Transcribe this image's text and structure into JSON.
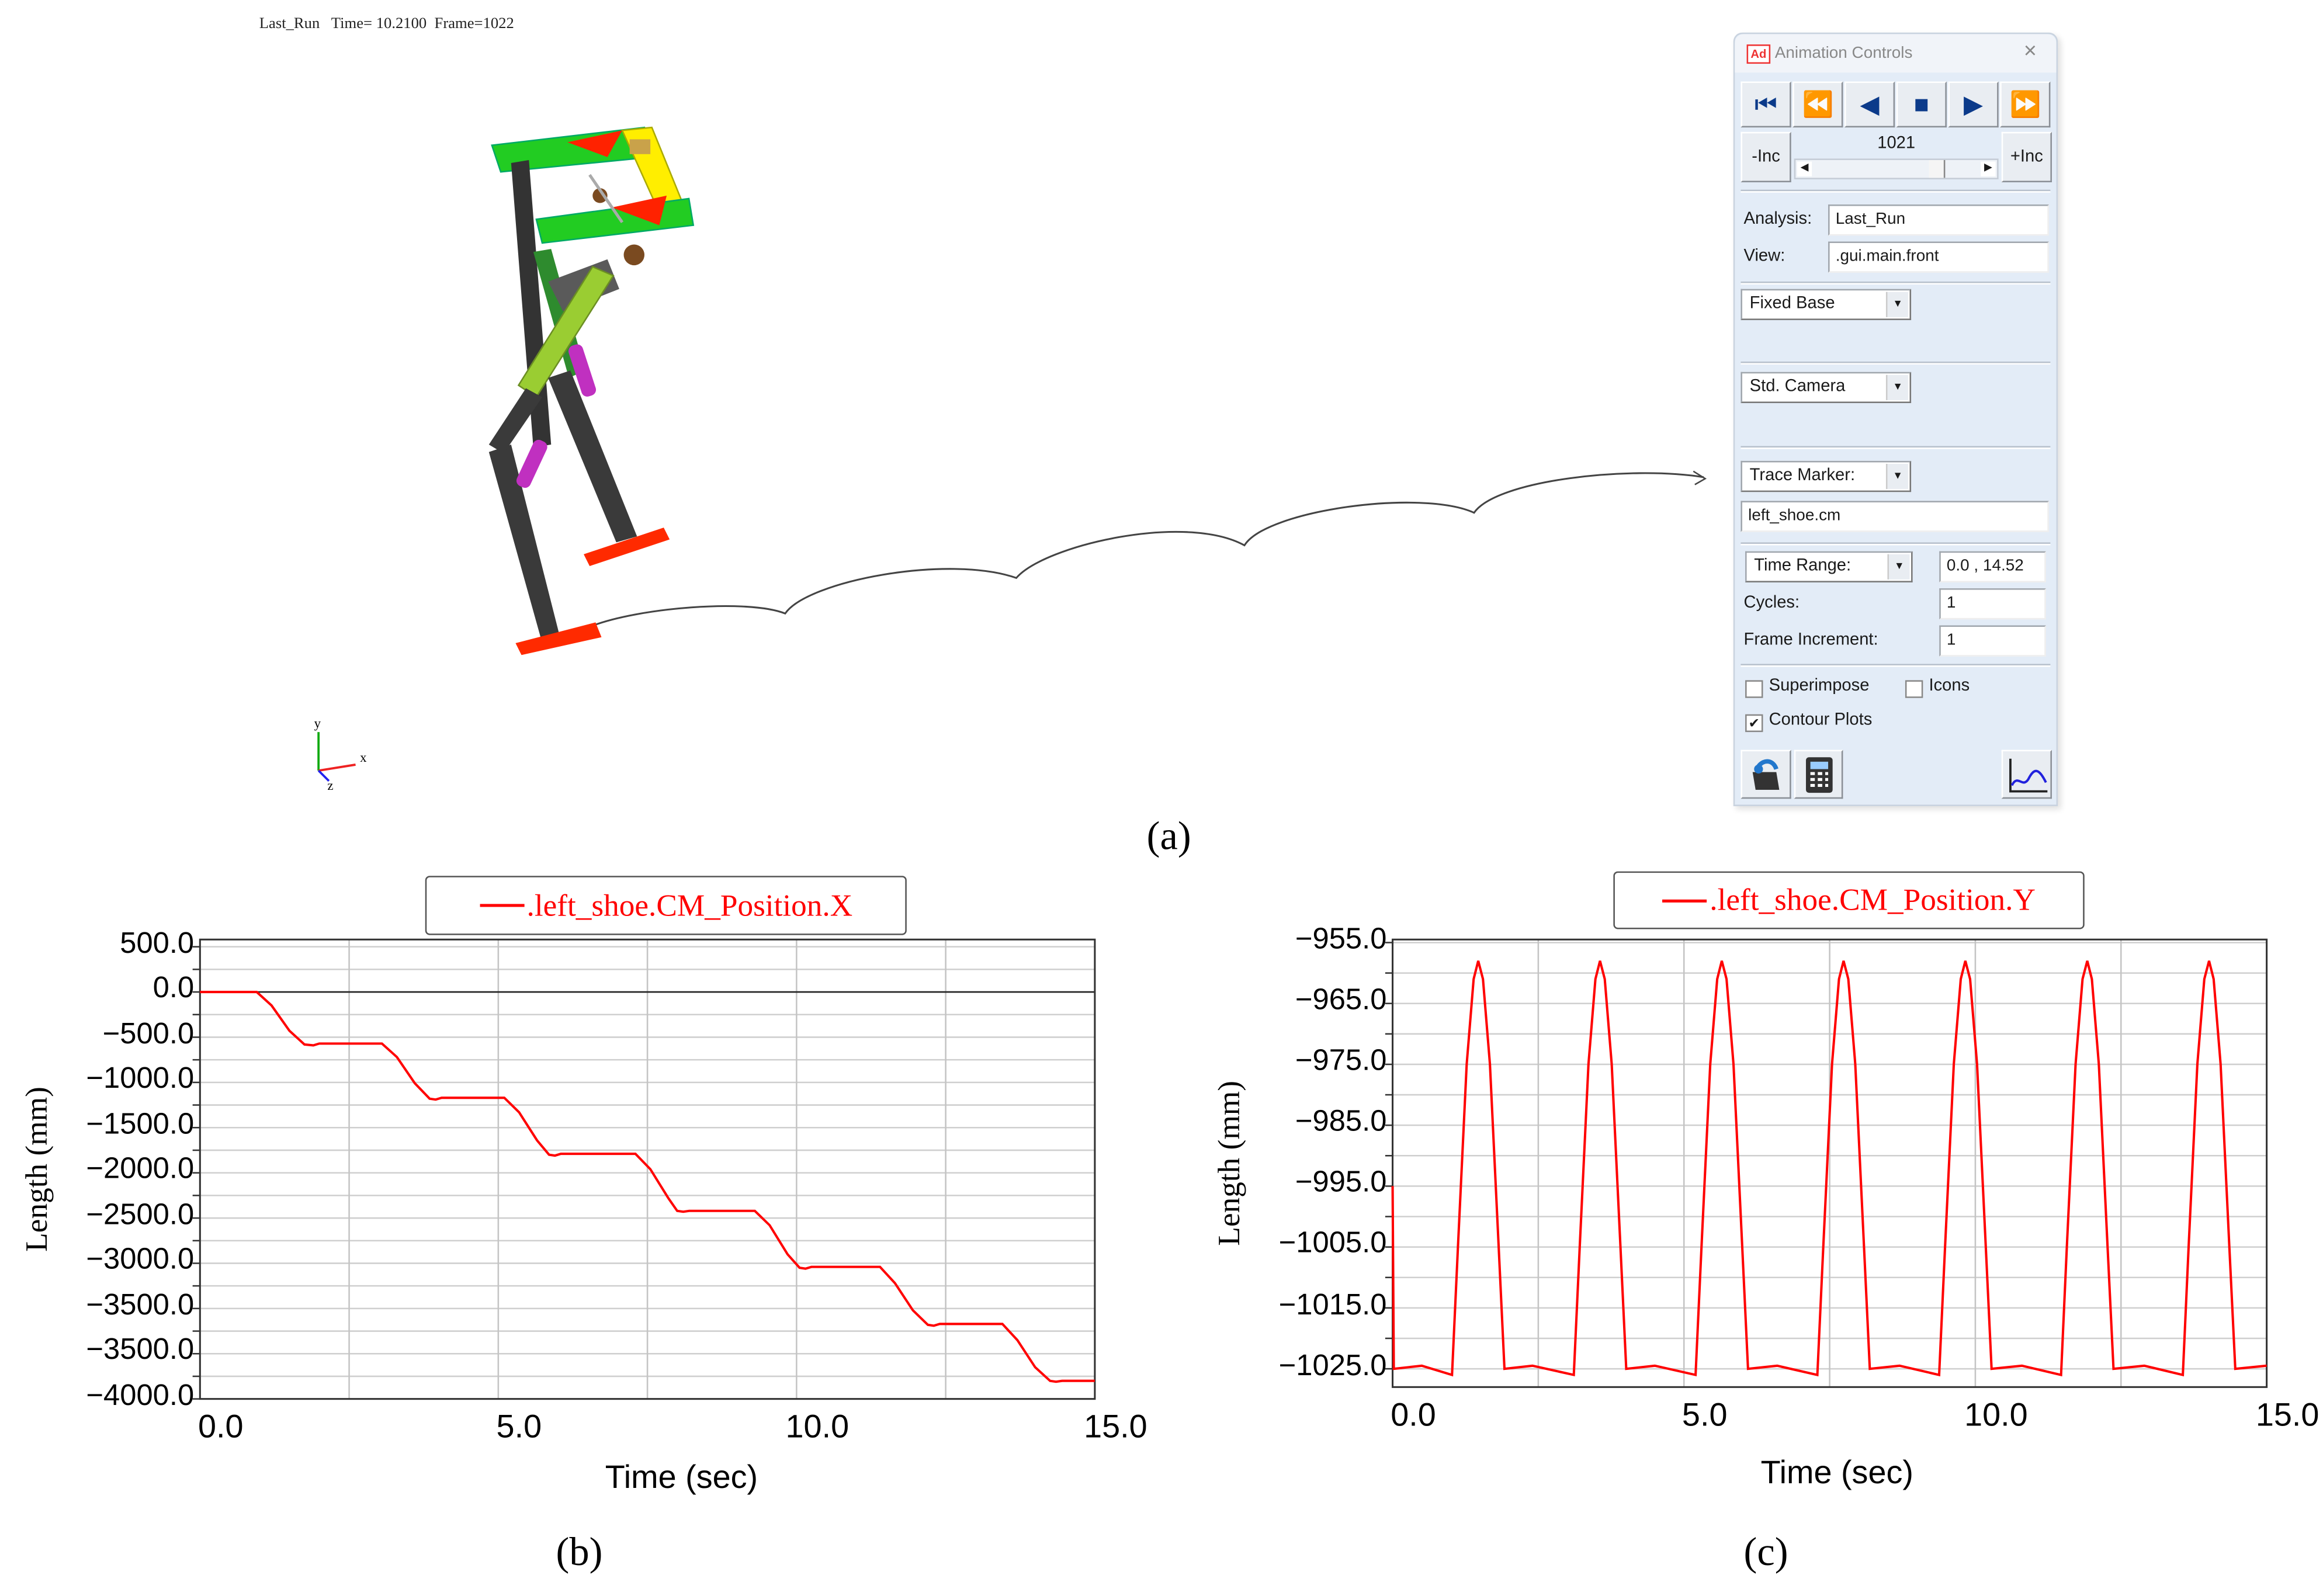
{
  "viewport": {
    "header": "Last_Run   Time= 10.2100  Frame=1022",
    "axis_labels": {
      "y": "y",
      "x": "x",
      "z": "z"
    },
    "trace_color": "#444444"
  },
  "captions": {
    "a": "(a)",
    "b": "(b)",
    "c": "(c)"
  },
  "animation_controls": {
    "app_icon": "Ad",
    "title": "Animation Controls",
    "close_icon": "×",
    "buttons": [
      {
        "name": "skip-to-start",
        "icon": "⏮"
      },
      {
        "name": "rewind",
        "icon": "⏪"
      },
      {
        "name": "play-reverse",
        "icon": "◀"
      },
      {
        "name": "stop",
        "icon": "■"
      },
      {
        "name": "play",
        "icon": "▶"
      },
      {
        "name": "fast-forward",
        "icon": "⏩"
      }
    ],
    "dec_label": "-Inc",
    "inc_label": "+Inc",
    "frame_value": "1021",
    "frame_slider_fraction": 0.7,
    "analysis_label": "Analysis:",
    "analysis_value": "Last_Run",
    "view_label": "View:",
    "view_value": ".gui.main.front",
    "base_select": "Fixed Base",
    "camera_select": "Std. Camera",
    "trace_select": "Trace Marker:",
    "trace_value": "left_shoe.cm",
    "time_select": "Time Range:",
    "time_value": "0.0 , 14.52",
    "cycles_label": "Cycles:",
    "cycles_value": "1",
    "frame_inc_label": "Frame Increment:",
    "frame_inc_value": "1",
    "superimpose_label": "Superimpose",
    "superimpose_checked": false,
    "icons_label": "Icons",
    "icons_checked": false,
    "contour_label": "Contour Plots",
    "contour_checked": true,
    "check_mark": "✔"
  },
  "chart_data": [
    {
      "type": "line",
      "legend": ".left_shoe.CM_Position.X",
      "legend_placement": "top-center",
      "xlabel": "Time (sec)",
      "ylabel": "Length (mm)",
      "xlim": [
        0,
        15
      ],
      "ylim": [
        -4500,
        580
      ],
      "x_ticks": [
        {
          "value": 0,
          "label": "0.0"
        },
        {
          "value": 5,
          "label": "5.0"
        },
        {
          "value": 10,
          "label": "10.0"
        },
        {
          "value": 15,
          "label": "15.0"
        }
      ],
      "y_ticks": [
        {
          "value": 500,
          "label": "500.0"
        },
        {
          "value": 0,
          "label": "0.0"
        },
        {
          "value": -500,
          "label": "−500.0"
        },
        {
          "value": -1000,
          "label": "−1000.0"
        },
        {
          "value": -1500,
          "label": "−1500.0"
        },
        {
          "value": -2000,
          "label": "−2000.0"
        },
        {
          "value": -2500,
          "label": "−2500.0"
        },
        {
          "value": -3000,
          "label": "−3000.0"
        },
        {
          "value": -3500,
          "label": "−3500.0"
        },
        {
          "value": -4000,
          "label": "−3500.0"
        },
        {
          "value": -4500,
          "label": "−4000.0"
        }
      ],
      "grid": true,
      "color": "#ff0000",
      "points": [
        [
          0,
          0
        ],
        [
          0.95,
          0
        ],
        [
          1.2,
          -150
        ],
        [
          1.5,
          -430
        ],
        [
          1.75,
          -580
        ],
        [
          1.9,
          -590
        ],
        [
          2.0,
          -570
        ],
        [
          3.05,
          -570
        ],
        [
          3.3,
          -720
        ],
        [
          3.6,
          -1010
        ],
        [
          3.85,
          -1180
        ],
        [
          3.95,
          -1190
        ],
        [
          4.05,
          -1170
        ],
        [
          5.1,
          -1170
        ],
        [
          5.35,
          -1330
        ],
        [
          5.65,
          -1640
        ],
        [
          5.85,
          -1800
        ],
        [
          5.95,
          -1810
        ],
        [
          6.05,
          -1790
        ],
        [
          7.3,
          -1790
        ],
        [
          7.55,
          -1960
        ],
        [
          7.85,
          -2280
        ],
        [
          8.0,
          -2420
        ],
        [
          8.1,
          -2430
        ],
        [
          8.2,
          -2420
        ],
        [
          9.3,
          -2420
        ],
        [
          9.55,
          -2580
        ],
        [
          9.85,
          -2900
        ],
        [
          10.05,
          -3050
        ],
        [
          10.15,
          -3060
        ],
        [
          10.25,
          -3040
        ],
        [
          11.4,
          -3040
        ],
        [
          11.65,
          -3220
        ],
        [
          11.95,
          -3520
        ],
        [
          12.2,
          -3680
        ],
        [
          12.3,
          -3690
        ],
        [
          12.4,
          -3670
        ],
        [
          13.45,
          -3670
        ],
        [
          13.7,
          -3850
        ],
        [
          14.0,
          -4150
        ],
        [
          14.25,
          -4300
        ],
        [
          14.35,
          -4310
        ],
        [
          14.45,
          -4300
        ],
        [
          15,
          -4300
        ]
      ]
    },
    {
      "type": "line",
      "legend": ".left_shoe.CM_Position.Y",
      "legend_placement": "top-center",
      "xlabel": "Time (sec)",
      "ylabel": "Length (mm)",
      "xlim": [
        0,
        15
      ],
      "ylim": [
        -1028,
        -954.5
      ],
      "x_ticks": [
        {
          "value": 0,
          "label": "0.0"
        },
        {
          "value": 5,
          "label": "5.0"
        },
        {
          "value": 10,
          "label": "10.0"
        },
        {
          "value": 15,
          "label": "15.0"
        }
      ],
      "y_ticks": [
        {
          "value": -955,
          "label": "−955.0"
        },
        {
          "value": -965,
          "label": "−965.0"
        },
        {
          "value": -975,
          "label": "−975.0"
        },
        {
          "value": -985,
          "label": "−985.0"
        },
        {
          "value": -995,
          "label": "−995.0"
        },
        {
          "value": -1005,
          "label": "−1005.0"
        },
        {
          "value": -1015,
          "label": "−1015.0"
        },
        {
          "value": -1025,
          "label": "−1025.0"
        }
      ],
      "grid": true,
      "color": "#ff0000",
      "points": [
        [
          0,
          -995
        ],
        [
          0.02,
          -1025
        ],
        [
          0.5,
          -1024.5
        ],
        [
          1.02,
          -1026
        ],
        [
          1.12,
          -1005
        ],
        [
          1.27,
          -975
        ],
        [
          1.39,
          -961
        ],
        [
          1.47,
          -958
        ],
        [
          1.55,
          -961
        ],
        [
          1.67,
          -975
        ],
        [
          1.82,
          -1005
        ],
        [
          1.92,
          -1025
        ],
        [
          2.4,
          -1024.5
        ],
        [
          3.11,
          -1026
        ],
        [
          3.21,
          -1005
        ],
        [
          3.36,
          -975
        ],
        [
          3.48,
          -961
        ],
        [
          3.56,
          -958
        ],
        [
          3.64,
          -961
        ],
        [
          3.76,
          -975
        ],
        [
          3.91,
          -1005
        ],
        [
          4.01,
          -1025
        ],
        [
          4.5,
          -1024.5
        ],
        [
          5.2,
          -1026
        ],
        [
          5.3,
          -1005
        ],
        [
          5.45,
          -975
        ],
        [
          5.57,
          -961
        ],
        [
          5.65,
          -958
        ],
        [
          5.73,
          -961
        ],
        [
          5.85,
          -975
        ],
        [
          6.0,
          -1005
        ],
        [
          6.1,
          -1025
        ],
        [
          6.6,
          -1024.5
        ],
        [
          7.29,
          -1026
        ],
        [
          7.39,
          -1005
        ],
        [
          7.54,
          -975
        ],
        [
          7.66,
          -961
        ],
        [
          7.74,
          -958
        ],
        [
          7.82,
          -961
        ],
        [
          7.94,
          -975
        ],
        [
          8.09,
          -1005
        ],
        [
          8.19,
          -1025
        ],
        [
          8.7,
          -1024.5
        ],
        [
          9.38,
          -1026
        ],
        [
          9.48,
          -1005
        ],
        [
          9.63,
          -975
        ],
        [
          9.75,
          -961
        ],
        [
          9.83,
          -958
        ],
        [
          9.91,
          -961
        ],
        [
          10.03,
          -975
        ],
        [
          10.18,
          -1005
        ],
        [
          10.28,
          -1025
        ],
        [
          10.8,
          -1024.5
        ],
        [
          11.47,
          -1026
        ],
        [
          11.57,
          -1005
        ],
        [
          11.72,
          -975
        ],
        [
          11.84,
          -961
        ],
        [
          11.92,
          -958
        ],
        [
          12.0,
          -961
        ],
        [
          12.12,
          -975
        ],
        [
          12.27,
          -1005
        ],
        [
          12.37,
          -1025
        ],
        [
          12.9,
          -1024.5
        ],
        [
          13.56,
          -1026
        ],
        [
          13.66,
          -1005
        ],
        [
          13.81,
          -975
        ],
        [
          13.93,
          -961
        ],
        [
          14.01,
          -958
        ],
        [
          14.09,
          -961
        ],
        [
          14.21,
          -975
        ],
        [
          14.36,
          -1005
        ],
        [
          14.46,
          -1025
        ],
        [
          15,
          -1024.5
        ]
      ]
    }
  ]
}
